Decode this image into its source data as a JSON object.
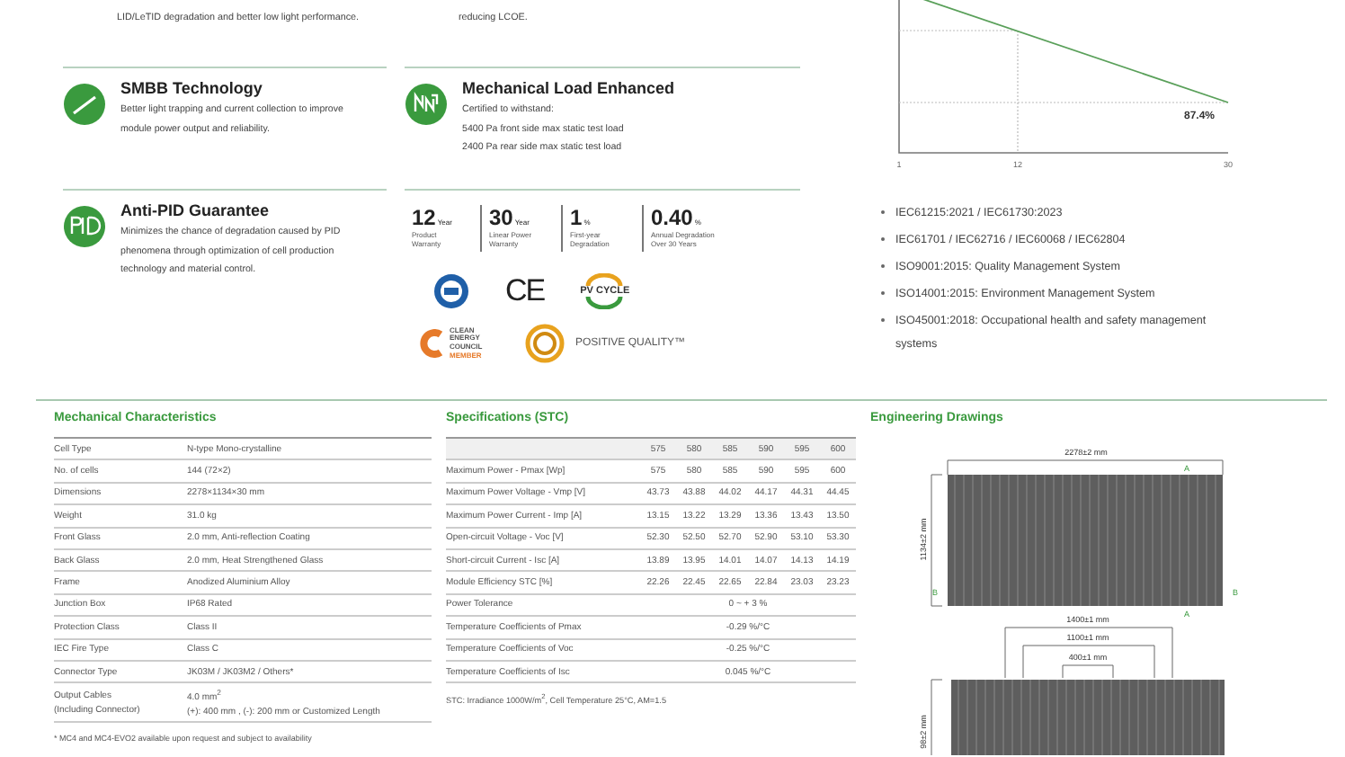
{
  "intro_left": "LID/LeTID degradation and better low light performance.",
  "intro_middle": "reducing LCOE.",
  "features_left": [
    {
      "kind": "busbar",
      "title": "SMBB Technology",
      "description": "Better light trapping and current collection to improve module power output and reliability."
    },
    {
      "kind": "pid",
      "title": "Anti-PID Guarantee",
      "description": "Minimizes the chance of degradation caused by PID phenomena through optimization of cell production technology and material control."
    }
  ],
  "features_middle": [
    {
      "kind": "load",
      "title": "Mechanical Load Enhanced",
      "lines": [
        "Certified to withstand:",
        "5400 Pa front side max static test load",
        "2400 Pa rear side max static test load"
      ]
    }
  ],
  "stats": [
    {
      "value": "12",
      "unit": "Year",
      "label": "Product Warranty"
    },
    {
      "value": "30",
      "unit": "Year",
      "label": "Linear Power Warranty"
    },
    {
      "value": "1",
      "unit": "%",
      "label": "First-year Degradation"
    },
    {
      "value": "0.40",
      "unit": "%",
      "label": "Annual Degradation Over 30 Years"
    }
  ],
  "logos": [
    {
      "kind": "tuv"
    },
    {
      "kind": "ce",
      "text": "CE"
    },
    {
      "kind": "pv_cycle",
      "text": "PV CYCLE"
    },
    {
      "kind": "cec",
      "text": "CLEAN ENERGY COUNCIL",
      "badge": "MEMBER"
    },
    {
      "kind": "positive_quality",
      "text": "POSITIVE QUALITY™"
    }
  ],
  "degradation_chart": {
    "x_labels": [
      "1",
      "12",
      "30"
    ],
    "end_label": "87.4%"
  },
  "certifications": [
    "IEC61215:2021 / IEC61730:2023",
    "IEC61701 / IEC62716 / IEC60068 / IEC62804",
    "ISO9001:2015: Quality Management System",
    "ISO14001:2015: Environment Management System",
    "ISO45001:2018: Occupational health and safety management systems"
  ],
  "mechanical": {
    "title": "Mechanical Characteristics",
    "rows": [
      {
        "label": "Cell Type",
        "value": "N-type Mono-crystalline"
      },
      {
        "label": "No. of cells",
        "value": "144 (72×2)"
      },
      {
        "label": "Dimensions",
        "value": "2278×1134×30 mm"
      },
      {
        "label": "Weight",
        "value": "31.0 kg"
      },
      {
        "label": "Front Glass",
        "value": "2.0 mm, Anti-reflection Coating"
      },
      {
        "label": "Back Glass",
        "value": "2.0 mm, Heat Strengthened Glass"
      },
      {
        "label": "Frame",
        "value": "Anodized Aluminium Alloy"
      },
      {
        "label": "Junction Box",
        "value": "IP68 Rated"
      },
      {
        "label": "Protection Class",
        "value": "Class II"
      },
      {
        "label": "IEC Fire Type",
        "value": "Class C"
      },
      {
        "label": "Connector Type",
        "value": "JK03M / JK03M2 / Others*"
      },
      {
        "label": "Output Cables",
        "sublabel": "(Including Connector)",
        "value": "4.0 mm$^{2}$",
        "subvalue": "(+): 400 mm , (-): 200 mm or Customized Length"
      }
    ],
    "footnote": "* MC4 and MC4-EVO2 available upon request and subject to availability"
  },
  "specifications": {
    "title": "Specifications (STC)",
    "columns": [
      "575",
      "580",
      "585",
      "590",
      "595",
      "600"
    ],
    "rows": [
      {
        "label": "Maximum Power - Pmax [Wp]",
        "values": [
          "575",
          "580",
          "585",
          "590",
          "595",
          "600"
        ]
      },
      {
        "label": "Maximum Power Voltage - Vmp [V]",
        "values": [
          "43.73",
          "43.88",
          "44.02",
          "44.17",
          "44.31",
          "44.45"
        ]
      },
      {
        "label": "Maximum Power Current - Imp [A]",
        "values": [
          "13.15",
          "13.22",
          "13.29",
          "13.36",
          "13.43",
          "13.50"
        ]
      },
      {
        "label": "Open-circuit Voltage - Voc [V]",
        "values": [
          "52.30",
          "52.50",
          "52.70",
          "52.90",
          "53.10",
          "53.30"
        ]
      },
      {
        "label": "Short-circuit Current - Isc [A]",
        "values": [
          "13.89",
          "13.95",
          "14.01",
          "14.07",
          "14.13",
          "14.19"
        ]
      },
      {
        "label": "Module Efficiency STC [%]",
        "values": [
          "22.26",
          "22.45",
          "22.65",
          "22.84",
          "23.03",
          "23.23"
        ]
      },
      {
        "label": "Power Tolerance",
        "span": "0 ~ + 3 %"
      },
      {
        "label": "Temperature Coefficients of Pmax",
        "span": "-0.29 %/°C"
      },
      {
        "label": "Temperature Coefficients of Voc",
        "span": "-0.25 %/°C"
      },
      {
        "label": "Temperature Coefficients of Isc",
        "span": "0.045 %/°C"
      }
    ],
    "note": "STC: Irradiance 1000W/m$^{2}$, Cell Temperature 25°C, AM=1.5"
  },
  "drawings": {
    "title": "Engineering Drawings",
    "width": "2278±2 mm",
    "height": "1134±2 mm",
    "section_labels": [
      "A",
      "A",
      "B",
      "B"
    ],
    "spacings": [
      "1400±1 mm",
      "1100±1 mm",
      "400±1 mm"
    ],
    "side_height": "98±2 mm"
  }
}
